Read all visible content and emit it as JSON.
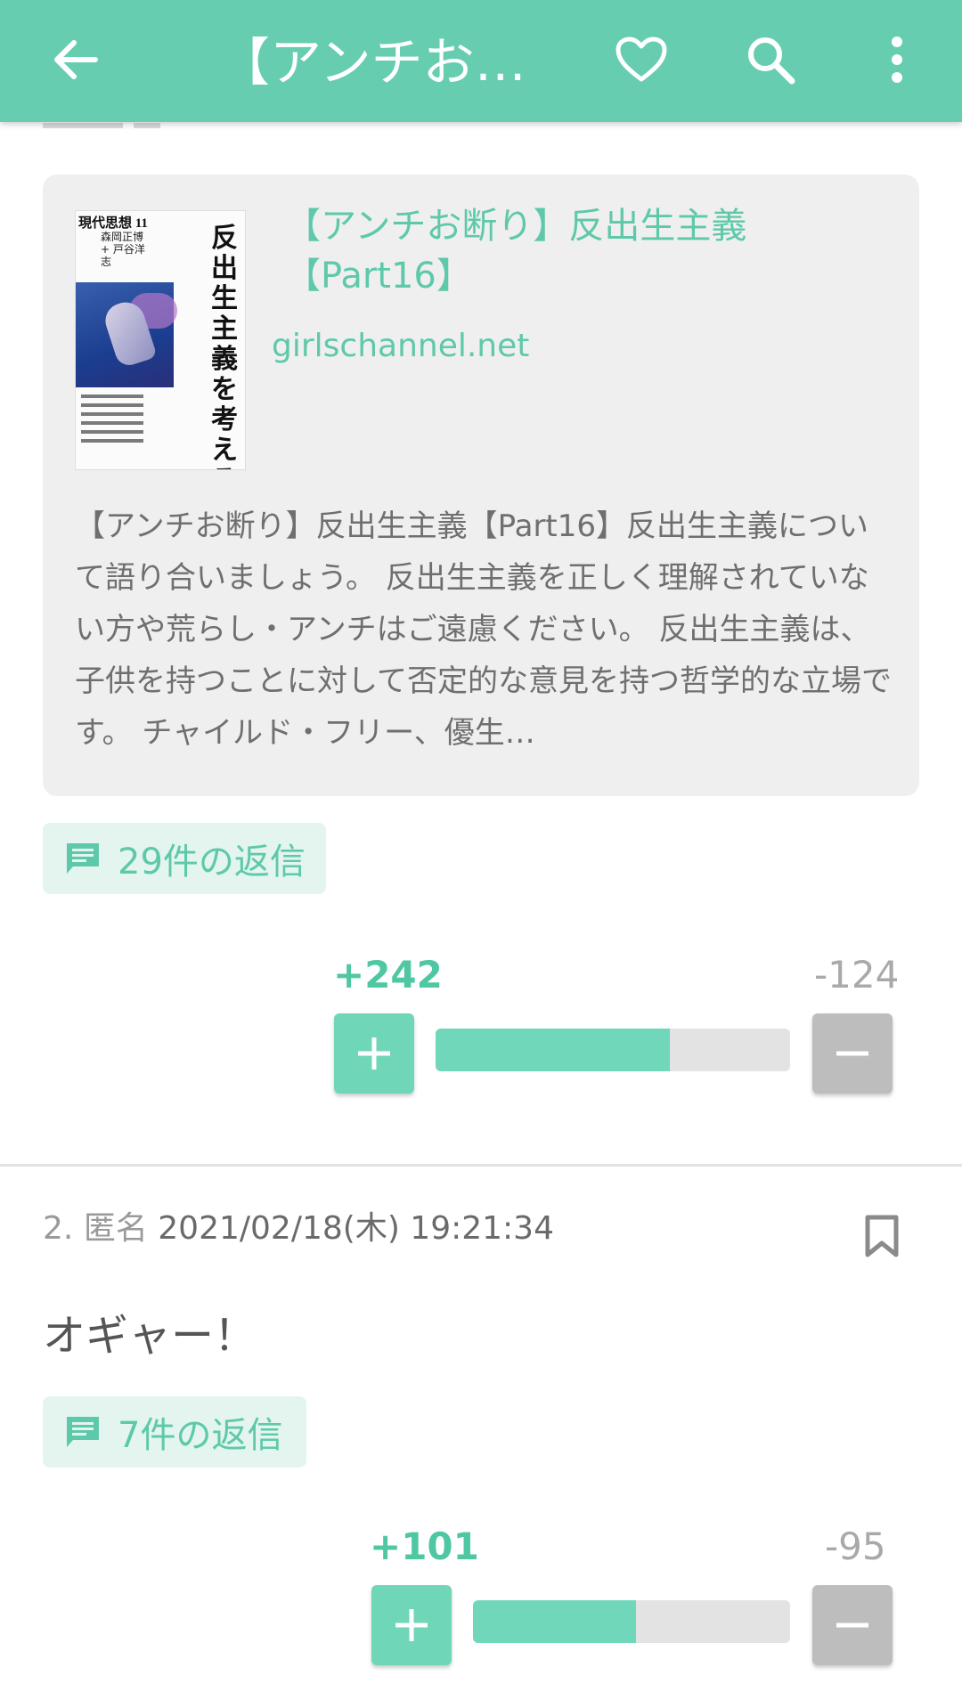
{
  "appbar": {
    "title": "【アンチお断…",
    "colors": {
      "bar": "#66cdb0",
      "icon": "#ffffff"
    }
  },
  "link_card": {
    "thumbnail": {
      "magazine": "現代思想 11",
      "authors": "森岡正博 + 戸谷洋志",
      "headline": "反出生主義を考える"
    },
    "title": "【アンチお断り】反出生主義【Part16】",
    "domain": "girlschannel.net",
    "description": "【アンチお断り】反出生主義【Part16】反出生主義について語り合いましょう。 反出生主義を正しく理解されていない方や荒らし・アンチはご遠慮ください。 反出生主義は、子供を持つことに対して否定的な意見を持つ哲学的な立場です。 チャイルド・フリー、優生…"
  },
  "post1": {
    "replies_label": "29件の返信",
    "plus": "+242",
    "minus": "-124",
    "plus_ratio": 0.661
  },
  "post2": {
    "number": "2.",
    "author": "匿名",
    "datetime": "2021/02/18(木) 19:21:34",
    "body": "オギャー！",
    "replies_label": "7件の返信",
    "plus": "+101",
    "minus": "-95",
    "plus_ratio": 0.515
  },
  "icons": [
    "arrow-left-icon",
    "heart-icon",
    "search-icon",
    "more-vert-icon",
    "comment-icon",
    "plus-icon",
    "minus-icon",
    "bookmark-icon"
  ],
  "accent": "#5ec9aa"
}
